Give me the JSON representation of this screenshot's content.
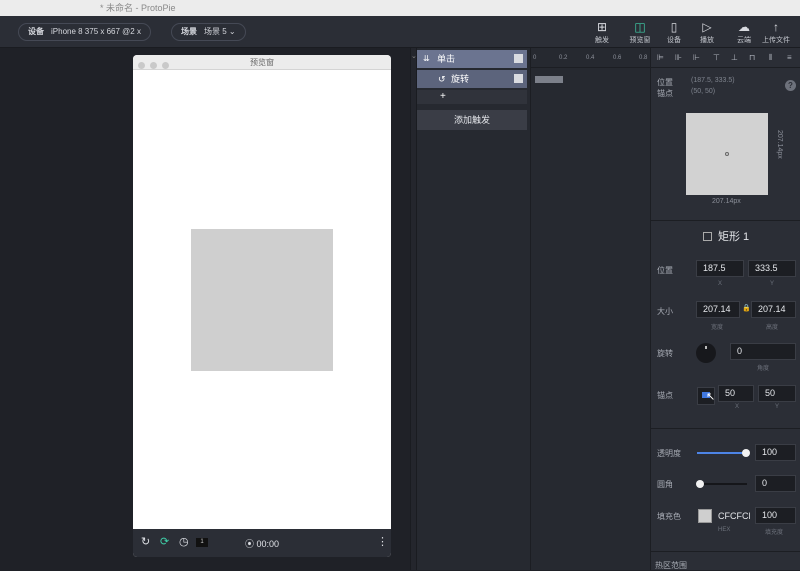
{
  "window_title": "* 未命名 - ProtoPie",
  "toolbar": {
    "device_label": "设备",
    "device_value": "iPhone 8  375 x 667  @2 x",
    "scene_label": "场景",
    "scene_value": "场景 5",
    "buttons": [
      {
        "label": "触发",
        "icon": "trigger-icon"
      },
      {
        "label": "预览窗",
        "icon": "preview-window-icon"
      },
      {
        "label": "设备",
        "icon": "device-icon"
      },
      {
        "label": "播放",
        "icon": "play-icon"
      },
      {
        "label": "云端",
        "icon": "cloud-icon"
      },
      {
        "label": "上传文件",
        "icon": "upload-icon"
      }
    ]
  },
  "preview": {
    "title": "预览窗",
    "rect_color": "#CFCFCF",
    "counter": "1",
    "time": "00:00"
  },
  "triggers": {
    "trigger_label": "单击",
    "response_label": "旋转",
    "add_response": "+",
    "add_trigger_button": "添加触发"
  },
  "timeline": {
    "ticks": [
      "0",
      "0.2",
      "0.4",
      "0.6",
      "0.8"
    ]
  },
  "properties": {
    "position_label": "位置",
    "position_value": "(187.5, 333.5)",
    "anchor_label": "锚点",
    "anchor_value": "(50, 50)",
    "thumb_width": "207.14px",
    "thumb_height": "207.14px",
    "layer_name": "矩形 1",
    "pos": {
      "label": "位置",
      "x": "187.5",
      "y": "333.5",
      "x_sub": "X",
      "y_sub": "Y"
    },
    "size": {
      "label": "大小",
      "w": "207.14",
      "h": "207.14",
      "w_sub": "宽度",
      "h_sub": "高度"
    },
    "rotation": {
      "label": "旋转",
      "value": "0",
      "sub": "角度"
    },
    "anchor": {
      "label": "锚点",
      "x": "50",
      "y": "50",
      "x_sub": "X",
      "y_sub": "Y"
    },
    "opacity": {
      "label": "透明度",
      "value": "100",
      "level": 1.0
    },
    "radius": {
      "label": "圆角",
      "value": "0",
      "level": 0.0
    },
    "fill": {
      "label": "填充色",
      "hex": "CFCFCF",
      "opacity": "100",
      "hex_sub": "HEX",
      "opacity_sub": "填充度"
    },
    "hit_area_label": "热区范围"
  }
}
